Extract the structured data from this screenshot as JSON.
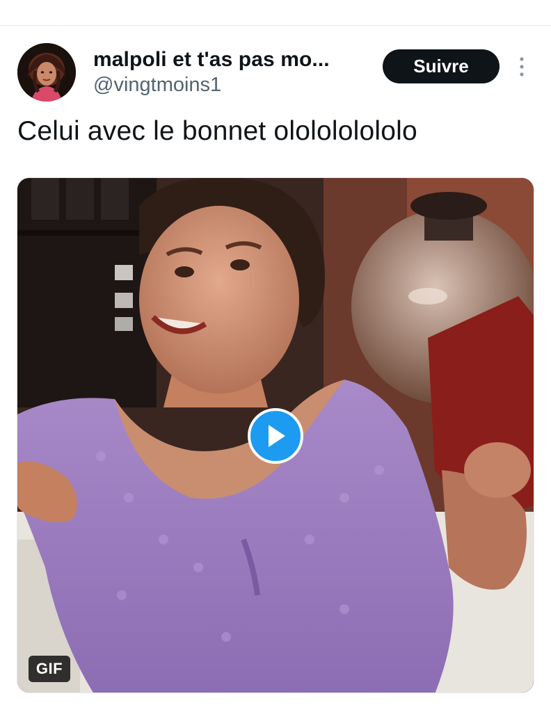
{
  "author": {
    "display_name": "malpoli et t'as pas mo...",
    "handle": "@vingtmoins1"
  },
  "actions": {
    "follow_label": "Suivre",
    "more_icon": "more-vertical-icon"
  },
  "tweet": {
    "text": "Celui avec le bonnet ololololololo"
  },
  "media": {
    "badge": "GIF",
    "play_icon": "play-icon"
  },
  "colors": {
    "accent": "#1d9bf0",
    "follow_bg": "#0f1419",
    "secondary_text": "#536471"
  }
}
